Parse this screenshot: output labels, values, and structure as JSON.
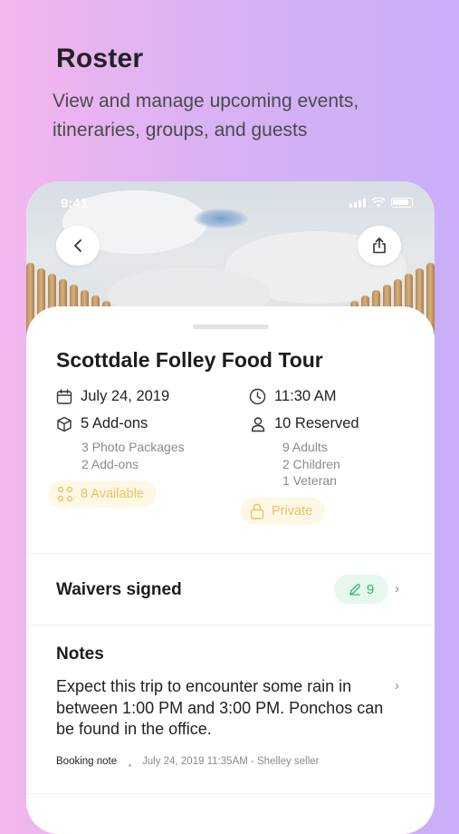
{
  "header": {
    "title": "Roster",
    "subtitle": "View and manage upcoming events, itineraries, groups, and guests"
  },
  "status_bar": {
    "time": "9:41"
  },
  "event": {
    "title": "Scottdale Folley Food Tour",
    "date": "July 24, 2019",
    "time": "11:30 AM",
    "addons_label": "5 Add-ons",
    "addons_details": [
      "3 Photo Packages",
      "2 Add-ons"
    ],
    "reserved_label": "10 Reserved",
    "reserved_details": [
      "9 Adults",
      "2 Children",
      "1 Veteran"
    ],
    "available_label": "8 Available",
    "visibility_label": "Private"
  },
  "waivers": {
    "label": "Waivers signed",
    "count": "9"
  },
  "notes": {
    "title": "Notes",
    "body": "Expect this trip to encounter some rain in between 1:00 PM and 3:00 PM. Ponchos can be found in the office.",
    "type_label": "Booking note",
    "meta": "July 24, 2019 11:35AM - Shelley seller"
  },
  "colors": {
    "available": "#f0c25d",
    "private": "#f0c25d",
    "waiver_badge": "#38b271",
    "background_start": "#f4b6ee",
    "background_end": "#c8aef8"
  },
  "icons": [
    "back-arrow-icon",
    "share-icon",
    "calendar-icon",
    "clock-icon",
    "box-icon",
    "person-icon",
    "grid-dots-icon",
    "lock-icon",
    "pencil-icon",
    "chevron-right-icon"
  ]
}
